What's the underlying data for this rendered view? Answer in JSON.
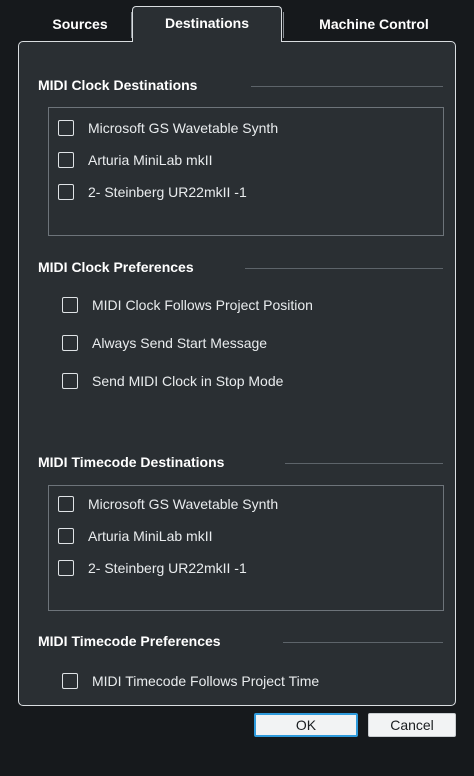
{
  "tabs": [
    {
      "label": "Sources"
    },
    {
      "label": "Destinations",
      "active": true
    },
    {
      "label": "Machine Control"
    }
  ],
  "sections": {
    "clock_destinations": {
      "title": "MIDI Clock Destinations",
      "items": [
        {
          "label": "Microsoft GS Wavetable Synth",
          "checked": false
        },
        {
          "label": "Arturia MiniLab mkII",
          "checked": false
        },
        {
          "label": "2- Steinberg UR22mkII -1",
          "checked": false
        }
      ]
    },
    "clock_preferences": {
      "title": "MIDI Clock Preferences",
      "items": [
        {
          "label": "MIDI Clock Follows Project Position",
          "checked": false
        },
        {
          "label": "Always Send Start Message",
          "checked": false
        },
        {
          "label": "Send MIDI Clock in Stop Mode",
          "checked": false
        }
      ]
    },
    "timecode_destinations": {
      "title": "MIDI Timecode Destinations",
      "items": [
        {
          "label": "Microsoft GS Wavetable Synth",
          "checked": false
        },
        {
          "label": "Arturia MiniLab mkII",
          "checked": false
        },
        {
          "label": "2- Steinberg UR22mkII -1",
          "checked": false
        }
      ]
    },
    "timecode_preferences": {
      "title": "MIDI Timecode Preferences",
      "items": [
        {
          "label": "MIDI Timecode Follows Project Time",
          "checked": false
        }
      ]
    }
  },
  "buttons": {
    "ok": "OK",
    "cancel": "Cancel"
  },
  "colors": {
    "background": "#16191c",
    "panel": "#2a2f33",
    "accent": "#2f9bdc"
  }
}
